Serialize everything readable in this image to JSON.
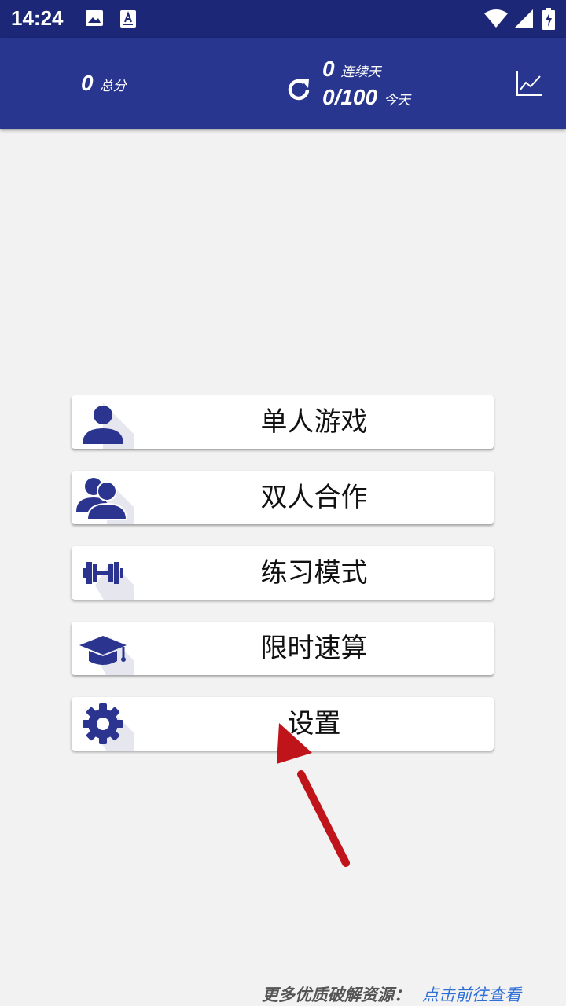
{
  "status_bar": {
    "time": "14:24"
  },
  "header": {
    "total_score": "0",
    "total_label": "总分",
    "streak_days": "0",
    "streak_label": "连续天",
    "today_progress": "0/100",
    "today_label": "今天"
  },
  "menu": [
    {
      "label": "单人游戏",
      "icon": "single-user-icon"
    },
    {
      "label": "双人合作",
      "icon": "two-users-icon"
    },
    {
      "label": "练习模式",
      "icon": "dumbbell-icon"
    },
    {
      "label": "限时速算",
      "icon": "graduation-cap-icon"
    },
    {
      "label": "设置",
      "icon": "gear-icon"
    }
  ],
  "footer": {
    "prefix": "更多优质破解资源：",
    "link": "点击前往查看"
  },
  "colors": {
    "header_bg": "#29368f",
    "status_bg": "#1c2777",
    "icon_color": "#2b3590",
    "annotation_arrow": "#c0141b",
    "link": "#2f6fd6"
  }
}
